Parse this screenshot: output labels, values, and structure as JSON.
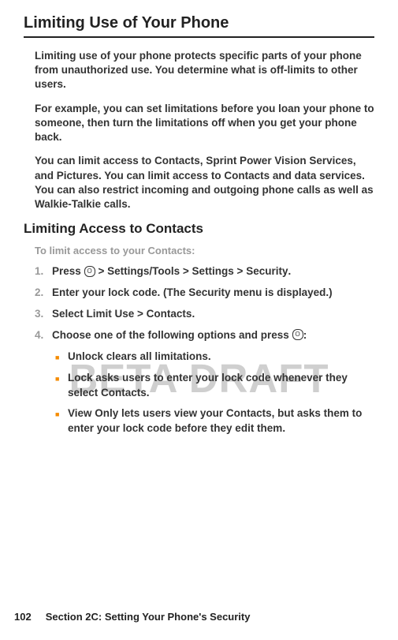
{
  "watermark": "BETA DRAFT",
  "heading_main": "Limiting Use of Your Phone",
  "intro": {
    "p1": "Limiting use of your phone protects specific parts of your phone from unauthorized use. You determine what is off-limits to other users.",
    "p2": "For example, you can set limitations before you loan your phone to someone, then turn the limitations off when you get your phone back.",
    "p3": "You can limit access to Contacts, Sprint Power Vision Services, and Pictures. You can limit access to Contacts and data services. You can also restrict incoming and outgoing phone calls as well as Walkie-Talkie calls."
  },
  "sub_heading": "Limiting Access to Contacts",
  "sub_intro": "To limit access to your Contacts:",
  "steps": {
    "s1_num": "1.",
    "s1_a": "Press ",
    "s1_key": "O",
    "s1_b": " > Settings/Tools > Settings > Security",
    "s1_c": ".",
    "s2_num": "2.",
    "s2": "Enter your lock code. (The Security menu is displayed.)",
    "s3_num": "3.",
    "s3_a": "Select ",
    "s3_b": "Limit Use > Contacts",
    "s3_c": ".",
    "s4_num": "4.",
    "s4_a": "Choose one of the following options and press ",
    "s4_key": "O",
    "s4_b": ":"
  },
  "bullets": {
    "b1_bold": "Unlock",
    "b1_rest": " clears all limitations.",
    "b2_bold": "Lock",
    "b2_rest_a": " asks users to enter your lock code whenever they select ",
    "b2_rest_bold": "Contacts",
    "b2_rest_b": ".",
    "b3_bold": "View Only",
    "b3_rest_a": " lets users view your ",
    "b3_rest_bold": "Contacts",
    "b3_rest_b": ", but asks them to enter your lock code before they edit them."
  },
  "footer": {
    "page": "102",
    "section": "Section 2C: Setting Your Phone's Security"
  }
}
